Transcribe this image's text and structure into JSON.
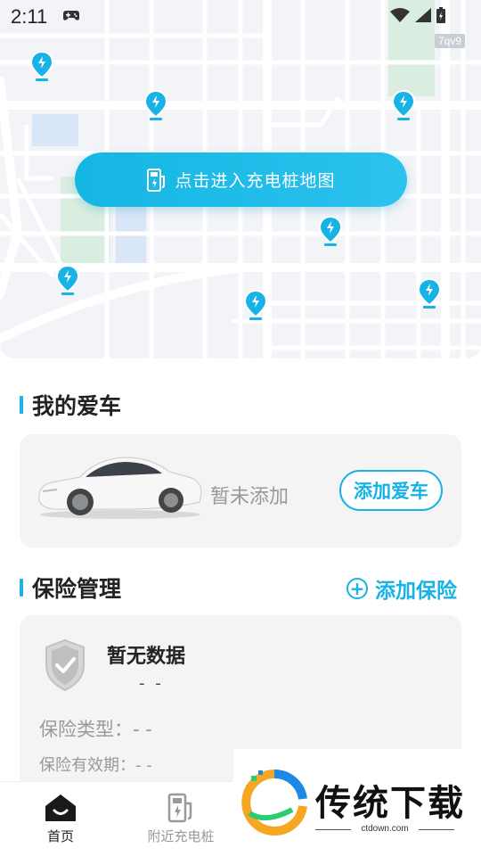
{
  "status_bar": {
    "time": "2:11"
  },
  "map": {
    "tag": "7qv9",
    "button_label": "点击进入充电桩地图"
  },
  "my_car": {
    "title": "我的爱车",
    "status": "暂未添加",
    "add_button": "添加爱车"
  },
  "insurance": {
    "title": "保险管理",
    "add_button": "添加保险",
    "card_title": "暂无数据",
    "card_subtitle": "- -",
    "type_label": "保险类型：- -",
    "validity_label": "保险有效期：- -"
  },
  "tabbar": {
    "items": [
      {
        "label": "首页",
        "icon": "home-icon",
        "active": true
      },
      {
        "label": "附近充电桩",
        "icon": "charging-pile-icon",
        "active": false
      }
    ]
  },
  "watermark": {
    "text": "传统下载",
    "sub": "ctdown.com"
  },
  "colors": {
    "accent": "#17b2e6",
    "map_background": "#f2f4f8",
    "card_background": "#f4f4f4"
  }
}
